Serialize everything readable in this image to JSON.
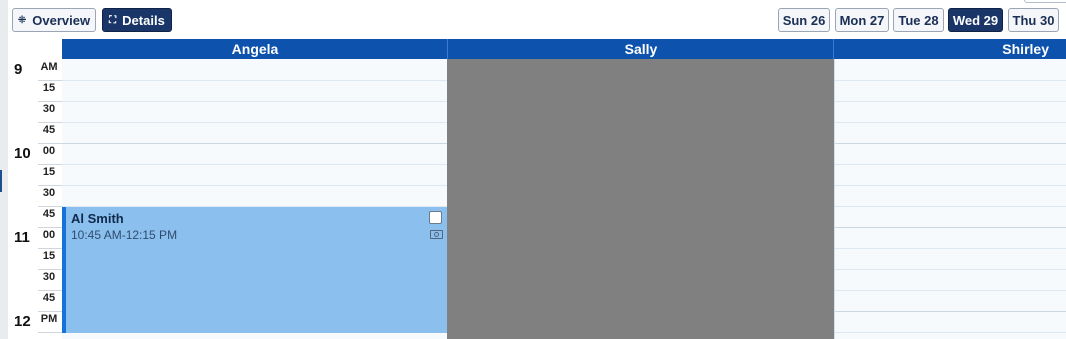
{
  "view_toggle": {
    "overview_label": "Overview",
    "details_label": "Details",
    "active": "Details"
  },
  "days": [
    {
      "label": "Sun 26",
      "active": false
    },
    {
      "label": "Mon 27",
      "active": false
    },
    {
      "label": "Tue 28",
      "active": false
    },
    {
      "label": "Wed 29",
      "active": true
    },
    {
      "label": "Thu 30",
      "active": false
    }
  ],
  "columns": [
    {
      "name": "Angela",
      "unavailable": false
    },
    {
      "name": "Sally",
      "unavailable": true
    },
    {
      "name": "Shirley",
      "unavailable": false
    }
  ],
  "time_gutter": {
    "labels": [
      {
        "hour": "9",
        "min": "AM"
      },
      {
        "hour": "",
        "min": "15"
      },
      {
        "hour": "",
        "min": "30"
      },
      {
        "hour": "",
        "min": "45"
      },
      {
        "hour": "10",
        "min": "00"
      },
      {
        "hour": "",
        "min": "15"
      },
      {
        "hour": "",
        "min": "30"
      },
      {
        "hour": "",
        "min": "45"
      },
      {
        "hour": "11",
        "min": "00"
      },
      {
        "hour": "",
        "min": "15"
      },
      {
        "hour": "",
        "min": "30"
      },
      {
        "hour": "",
        "min": "45"
      },
      {
        "hour": "12",
        "min": "PM"
      }
    ]
  },
  "event": {
    "title": "Al Smith",
    "time": "10:45 AM-12:15 PM",
    "column": "Angela"
  },
  "colors": {
    "header": "#0d52ad",
    "event_bg": "#8bbfee",
    "event_border": "#1572d8",
    "unavailable": "#808080",
    "slot_bg": "#f6fafd",
    "active_day": "#1a3668"
  }
}
